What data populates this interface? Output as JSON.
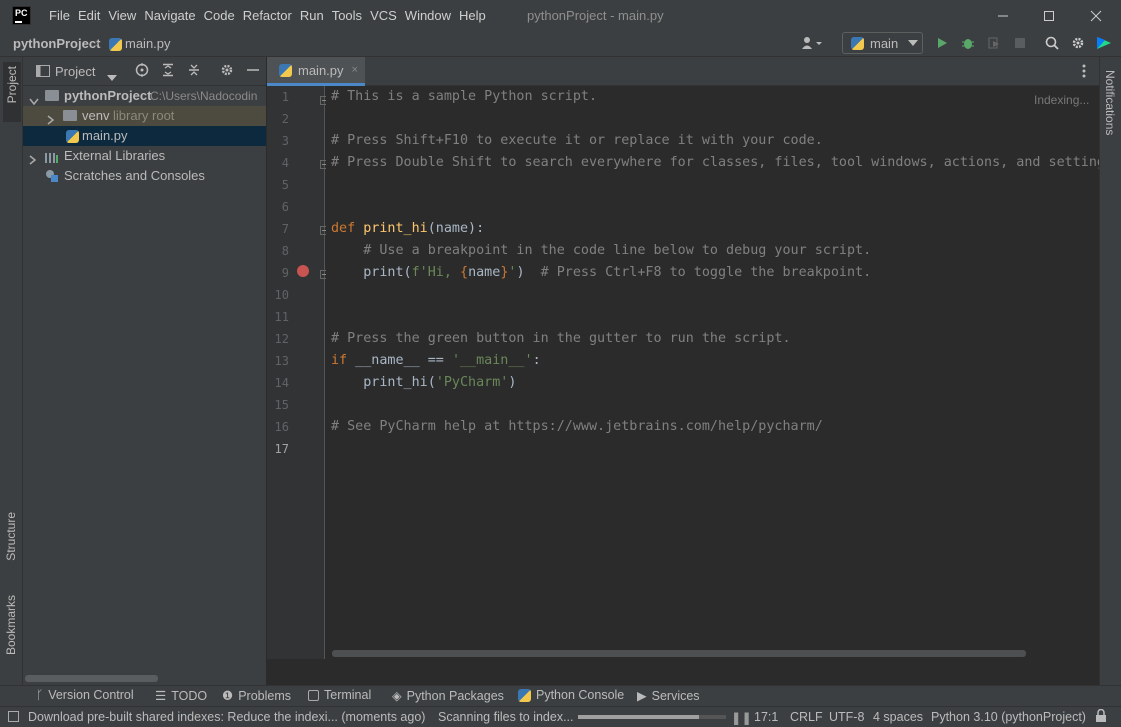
{
  "app": {
    "logo_text": "PC",
    "window_title": "pythonProject - main.py"
  },
  "menu": [
    "File",
    "Edit",
    "View",
    "Navigate",
    "Code",
    "Refactor",
    "Run",
    "Tools",
    "VCS",
    "Window",
    "Help"
  ],
  "nav": {
    "project": "pythonProject",
    "file": "main.py",
    "run_config": "main"
  },
  "left_strip": {
    "project": "Project",
    "structure": "Structure",
    "bookmarks": "Bookmarks"
  },
  "right_strip": {
    "notifications": "Notifications"
  },
  "project_panel": {
    "title": "Project",
    "tree": {
      "root_name": "pythonProject",
      "root_path": "C:\\Users\\Nadocodin",
      "venv_name": "venv",
      "venv_note": "library root",
      "file": "main.py",
      "external": "External Libraries",
      "scratches": "Scratches and Consoles"
    }
  },
  "editor": {
    "tab": "main.py",
    "indexing": "Indexing...",
    "lines": [
      "1",
      "2",
      "3",
      "4",
      "5",
      "6",
      "7",
      "8",
      "9",
      "10",
      "11",
      "12",
      "13",
      "14",
      "15",
      "16",
      "17"
    ],
    "code": {
      "l1": "# This is a sample Python script.",
      "l3": "# Press Shift+F10 to execute it or replace it with your code.",
      "l4": "# Press Double Shift to search everywhere for classes, files, tool windows, actions, and settings.",
      "l7_kw": "def",
      "l7_fn": "print_hi",
      "l7_rest": "(name):",
      "l8": "# Use a breakpoint in the code line below to debug your script.",
      "l9_a": "print(",
      "l9_str1": "f'Hi, ",
      "l9_brace1": "{",
      "l9_var": "name",
      "l9_brace2": "}",
      "l9_str2": "'",
      "l9_b": ")",
      "l9_cmt": "# Press Ctrl+F8 to toggle the breakpoint.",
      "l12": "# Press the green button in the gutter to run the script.",
      "l13_kw": "if",
      "l13_mid": " __name__ == ",
      "l13_str": "'__main__'",
      "l13_end": ":",
      "l14_a": "print_hi(",
      "l14_str": "'PyCharm'",
      "l14_b": ")",
      "l16": "# See PyCharm help at https://www.jetbrains.com/help/pycharm/"
    }
  },
  "bottom_tools": {
    "version_control": "Version Control",
    "todo": "TODO",
    "problems": "Problems",
    "terminal": "Terminal",
    "python_packages": "Python Packages",
    "python_console": "Python Console",
    "services": "Services"
  },
  "status": {
    "message": "Download pre-built shared indexes: Reduce the indexi... (moments ago)",
    "scanning": "Scanning files to index...",
    "position": "17:1",
    "line_sep": "CRLF",
    "encoding": "UTF-8",
    "indent": "4 spaces",
    "interpreter": "Python 3.10 (pythonProject)"
  },
  "colors": {
    "accent": "#4a88c7",
    "run_green": "#59a869",
    "breakpoint": "#c75450"
  }
}
